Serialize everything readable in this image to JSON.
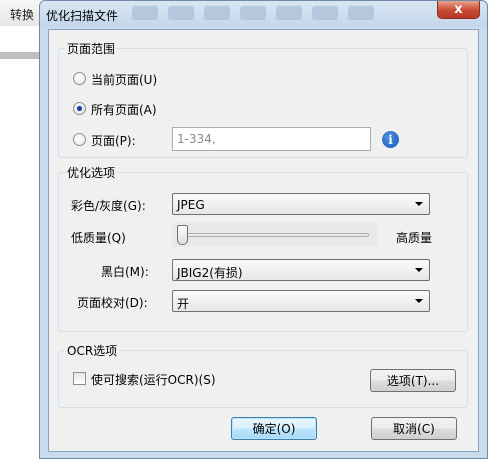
{
  "background_app": {
    "toolbar_label": "转换"
  },
  "dialog": {
    "title": "优化扫描文件",
    "close_label": "x",
    "page_range": {
      "legend": "页面范围",
      "option_current": "当前页面(U)",
      "option_all": "所有页面(A)",
      "option_pages": "页面(P):",
      "selected": "所有页面(A)",
      "pages_placeholder": "1-334,"
    },
    "optimize": {
      "legend": "优化选项",
      "color_label": "彩色/灰度(G):",
      "color_value": "JPEG",
      "quality_low": "低质量(Q)",
      "quality_high": "高质量",
      "quality_level": 0.0,
      "bw_label": "黑白(M):",
      "bw_value": "JBIG2(有损)",
      "deskew_label": "页面校对(D):",
      "deskew_value": "开"
    },
    "ocr": {
      "legend": "OCR选项",
      "searchable_label": "使可搜索(运行OCR)(S)",
      "searchable_checked": false,
      "options_button": "选项(T)..."
    },
    "ok_button": "确定(O)",
    "cancel_button": "取消(C)"
  },
  "colors": {
    "title_bar": "#c3d6ea",
    "close_button": "#c84a33",
    "client_background": "#f0f0f0",
    "default_button_border": "#3c7fb1",
    "info_icon": "#1659b8"
  }
}
